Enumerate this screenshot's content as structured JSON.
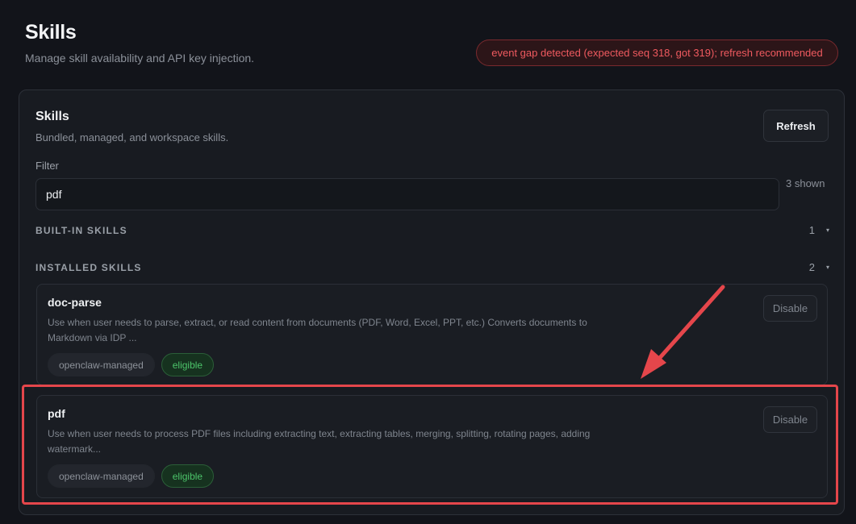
{
  "header": {
    "title": "Skills",
    "subtitle": "Manage skill availability and API key injection."
  },
  "error_banner": {
    "message": "event gap detected (expected seq 318, got 319); refresh recommended"
  },
  "card": {
    "title": "Skills",
    "subtitle": "Bundled, managed, and workspace skills.",
    "refresh_label": "Refresh",
    "filter_label": "Filter",
    "filter_value": "pdf",
    "shown_count": "3 shown"
  },
  "sections": {
    "builtin": {
      "title": "BUILT-IN SKILLS",
      "count": "1"
    },
    "installed": {
      "title": "INSTALLED SKILLS",
      "count": "2"
    }
  },
  "skills": [
    {
      "name": "doc-parse",
      "description": "Use when user needs to parse, extract, or read content from documents (PDF, Word, Excel, PPT, etc.) Converts documents to Markdown via IDP ...",
      "action_label": "Disable",
      "source_tag": "openclaw-managed",
      "status_tag": "eligible"
    },
    {
      "name": "pdf",
      "description": "Use when user needs to process PDF files including extracting text, extracting tables, merging, splitting, rotating pages, adding watermark...",
      "action_label": "Disable",
      "source_tag": "openclaw-managed",
      "status_tag": "eligible"
    }
  ],
  "colors": {
    "background": "#12141a",
    "card": "#181b21",
    "error": "#ef5a5f",
    "eligible": "#4cc46a",
    "annotation": "#e5464b"
  },
  "icons": {
    "section_toggle": "triangle-down-icon"
  }
}
